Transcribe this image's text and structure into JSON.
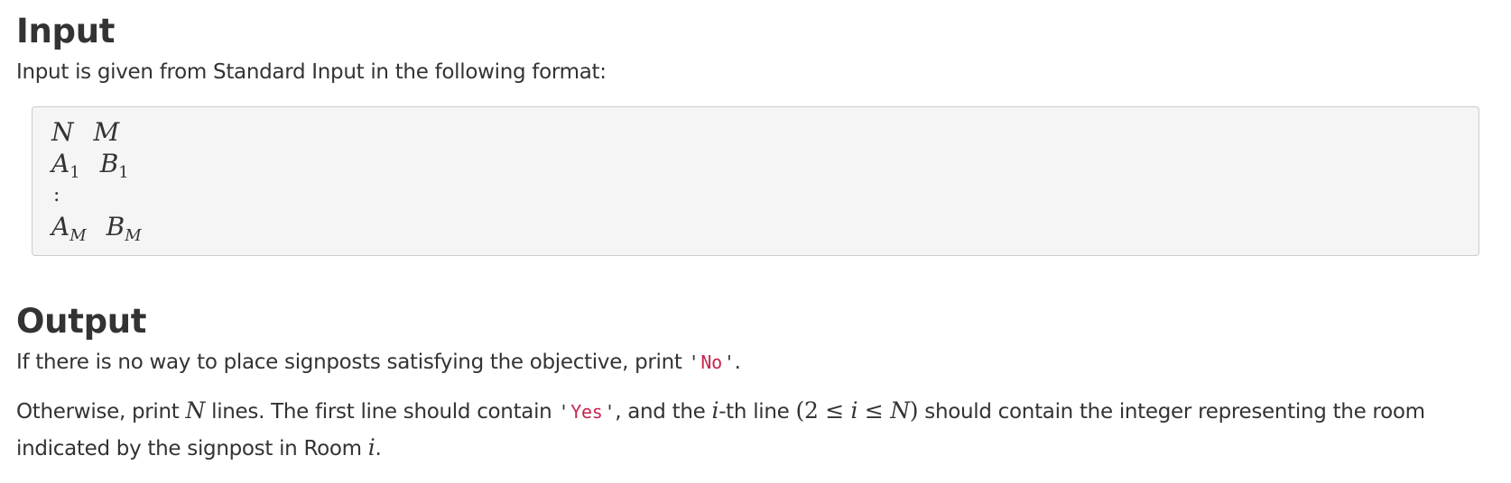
{
  "input_section": {
    "heading": "Input",
    "intro": "Input is given from Standard Input in the following format:",
    "format": {
      "line1": {
        "a": "N",
        "b": "M"
      },
      "line2": {
        "a": "A",
        "a_sub": "1",
        "b": "B",
        "b_sub": "1"
      },
      "vdots": ":",
      "line4": {
        "a": "A",
        "a_sub": "M",
        "b": "B",
        "b_sub": "M"
      }
    }
  },
  "output_section": {
    "heading": "Output",
    "p1": {
      "text_before": "If there is no way to place signposts satisfying the objective, print ",
      "quote_open": "'",
      "code": "No",
      "quote_close": "'",
      "text_after": "."
    },
    "p2": {
      "text1": "Otherwise, print ",
      "var_n": "N",
      "text2": " lines. The first line should contain ",
      "quote_open": "'",
      "code": "Yes",
      "quote_close": "'",
      "text3": ", and the ",
      "var_i": "i",
      "text4": "-th line ",
      "paren_open": "(",
      "num2": "2",
      "le1": " ≤ ",
      "var_i2": "i",
      "le2": " ≤ ",
      "var_n2": "N",
      "paren_close": ")",
      "text5": " should contain the integer representing the room indicated by the signpost in Room ",
      "var_i3": "i",
      "text6": "."
    }
  },
  "colors": {
    "text": "#333333",
    "code": "#c7254e",
    "box_bg": "#f5f5f5",
    "box_border": "#cccccc"
  }
}
